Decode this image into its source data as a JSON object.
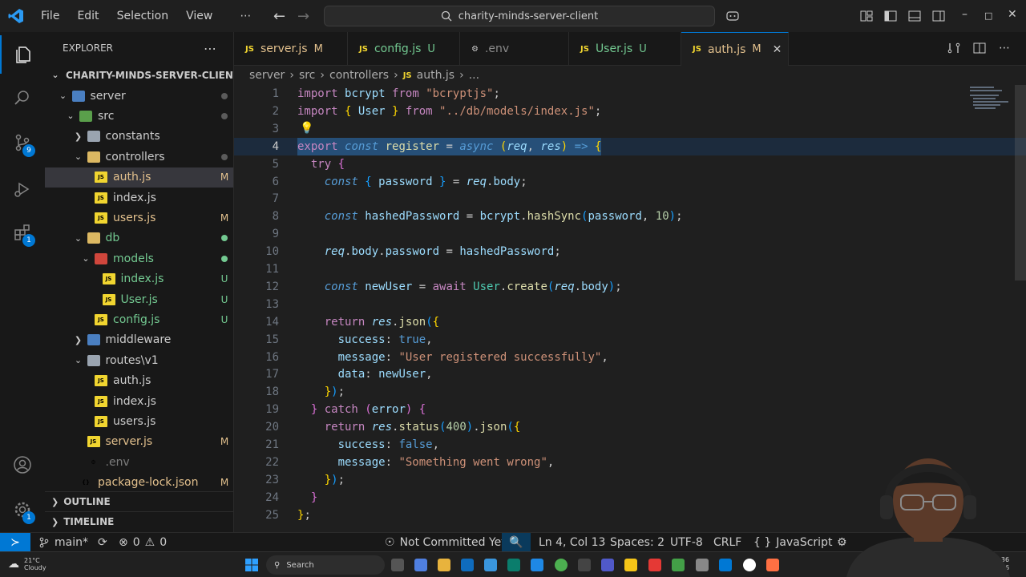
{
  "menu": [
    "File",
    "Edit",
    "Selection",
    "View",
    "⋯"
  ],
  "command_center": "charity-minds-server-client",
  "explorer": {
    "title": "EXPLORER",
    "root": "CHARITY-MINDS-SERVER-CLIENT",
    "tree": [
      {
        "label": "server",
        "kind": "folder",
        "color": "blue",
        "open": true,
        "indent": 1,
        "status": "dot"
      },
      {
        "label": "src",
        "kind": "folder",
        "color": "green",
        "open": true,
        "indent": 2,
        "status": "dot"
      },
      {
        "label": "constants",
        "kind": "folder",
        "color": "gray",
        "open": false,
        "indent": 3,
        "status": ""
      },
      {
        "label": "controllers",
        "kind": "folder",
        "color": "yellow",
        "open": true,
        "indent": 3,
        "status": "dot"
      },
      {
        "label": "auth.js",
        "kind": "js",
        "indent": 4,
        "status": "M",
        "state": "mod",
        "selected": true
      },
      {
        "label": "index.js",
        "kind": "js",
        "indent": 4,
        "status": "",
        "state": ""
      },
      {
        "label": "users.js",
        "kind": "js",
        "indent": 4,
        "status": "M",
        "state": "mod"
      },
      {
        "label": "db",
        "kind": "folder",
        "color": "yellow",
        "open": true,
        "indent": 3,
        "status": "dot",
        "state": "untracked"
      },
      {
        "label": "models",
        "kind": "folder",
        "color": "red",
        "open": true,
        "indent": 4,
        "status": "dot",
        "state": "untracked"
      },
      {
        "label": "index.js",
        "kind": "js",
        "indent": 5,
        "status": "U",
        "state": "untracked"
      },
      {
        "label": "User.js",
        "kind": "js",
        "indent": 5,
        "status": "U",
        "state": "untracked"
      },
      {
        "label": "config.js",
        "kind": "js",
        "indent": 4,
        "status": "U",
        "state": "untracked"
      },
      {
        "label": "middleware",
        "kind": "folder",
        "color": "blue",
        "open": false,
        "indent": 3,
        "status": ""
      },
      {
        "label": "routes\\v1",
        "kind": "folder",
        "color": "gray",
        "open": true,
        "indent": 3,
        "status": ""
      },
      {
        "label": "auth.js",
        "kind": "js",
        "indent": 4,
        "status": "",
        "state": ""
      },
      {
        "label": "index.js",
        "kind": "js",
        "indent": 4,
        "status": "",
        "state": ""
      },
      {
        "label": "users.js",
        "kind": "js",
        "indent": 4,
        "status": "",
        "state": ""
      },
      {
        "label": "server.js",
        "kind": "js",
        "indent": 3,
        "status": "M",
        "state": "mod"
      },
      {
        "label": ".env",
        "kind": "env",
        "indent": 3,
        "status": "",
        "state": "dim"
      },
      {
        "label": "package-lock.json",
        "kind": "json",
        "indent": 2,
        "status": "M",
        "state": "mod"
      }
    ],
    "outline": "OUTLINE",
    "timeline": "TIMELINE"
  },
  "tabs": [
    {
      "label": "server.js",
      "state": "M",
      "kind": "js"
    },
    {
      "label": "config.js",
      "state": "U",
      "kind": "js"
    },
    {
      "label": ".env",
      "state": "",
      "kind": "env"
    },
    {
      "label": "User.js",
      "state": "U",
      "kind": "js"
    },
    {
      "label": "auth.js",
      "state": "M",
      "kind": "js",
      "active": true
    }
  ],
  "breadcrumb": [
    "server",
    "src",
    "controllers",
    "auth.js",
    "..."
  ],
  "code": [
    [
      [
        "kw",
        "import "
      ],
      [
        "var",
        "bcrypt "
      ],
      [
        "kw",
        "from "
      ],
      [
        "str",
        "\"bcryptjs\""
      ],
      [
        "pun",
        ";"
      ]
    ],
    [
      [
        "kw",
        "import "
      ],
      [
        "br1",
        "{ "
      ],
      [
        "var",
        "User "
      ],
      [
        "br1",
        "} "
      ],
      [
        "kw",
        "from "
      ],
      [
        "str",
        "\"../db/models/index.js\""
      ],
      [
        "pun",
        ";"
      ]
    ],
    [],
    [
      [
        "kw",
        "export "
      ],
      [
        "kwb",
        "const "
      ],
      [
        "fn",
        "register "
      ],
      [
        "pun",
        "= "
      ],
      [
        "kwb",
        "async "
      ],
      [
        "br1",
        "("
      ],
      [
        "param",
        "req"
      ],
      [
        "pun",
        ", "
      ],
      [
        "param",
        "res"
      ],
      [
        "br1",
        ") "
      ],
      [
        "kwb",
        "=> "
      ],
      [
        "br1",
        "{"
      ]
    ],
    [
      [
        "pun",
        "  "
      ],
      [
        "kw",
        "try "
      ],
      [
        "br2",
        "{"
      ]
    ],
    [
      [
        "pun",
        "    "
      ],
      [
        "kwb",
        "const "
      ],
      [
        "br3",
        "{ "
      ],
      [
        "var",
        "password "
      ],
      [
        "br3",
        "} "
      ],
      [
        "pun",
        "= "
      ],
      [
        "param",
        "req"
      ],
      [
        "pun",
        "."
      ],
      [
        "var",
        "body"
      ],
      [
        "pun",
        ";"
      ]
    ],
    [],
    [
      [
        "pun",
        "    "
      ],
      [
        "kwb",
        "const "
      ],
      [
        "var",
        "hashedPassword "
      ],
      [
        "pun",
        "= "
      ],
      [
        "var",
        "bcrypt"
      ],
      [
        "pun",
        "."
      ],
      [
        "fn",
        "hashSync"
      ],
      [
        "br3",
        "("
      ],
      [
        "var",
        "password"
      ],
      [
        "pun",
        ", "
      ],
      [
        "num",
        "10"
      ],
      [
        "br3",
        ")"
      ],
      [
        "pun",
        ";"
      ]
    ],
    [],
    [
      [
        "pun",
        "    "
      ],
      [
        "param",
        "req"
      ],
      [
        "pun",
        "."
      ],
      [
        "var",
        "body"
      ],
      [
        "pun",
        "."
      ],
      [
        "var",
        "password "
      ],
      [
        "pun",
        "= "
      ],
      [
        "var",
        "hashedPassword"
      ],
      [
        "pun",
        ";"
      ]
    ],
    [],
    [
      [
        "pun",
        "    "
      ],
      [
        "kwb",
        "const "
      ],
      [
        "var",
        "newUser "
      ],
      [
        "pun",
        "= "
      ],
      [
        "kw",
        "await "
      ],
      [
        "cls",
        "User"
      ],
      [
        "pun",
        "."
      ],
      [
        "fn",
        "create"
      ],
      [
        "br3",
        "("
      ],
      [
        "param",
        "req"
      ],
      [
        "pun",
        "."
      ],
      [
        "var",
        "body"
      ],
      [
        "br3",
        ")"
      ],
      [
        "pun",
        ";"
      ]
    ],
    [],
    [
      [
        "pun",
        "    "
      ],
      [
        "kw",
        "return "
      ],
      [
        "param",
        "res"
      ],
      [
        "pun",
        "."
      ],
      [
        "fn",
        "json"
      ],
      [
        "br3",
        "("
      ],
      [
        "br1",
        "{"
      ]
    ],
    [
      [
        "pun",
        "      "
      ],
      [
        "var",
        "success"
      ],
      [
        "pun",
        ": "
      ],
      [
        "bool",
        "true"
      ],
      [
        "pun",
        ","
      ]
    ],
    [
      [
        "pun",
        "      "
      ],
      [
        "var",
        "message"
      ],
      [
        "pun",
        ": "
      ],
      [
        "str",
        "\"User registered successfully\""
      ],
      [
        "pun",
        ","
      ]
    ],
    [
      [
        "pun",
        "      "
      ],
      [
        "var",
        "data"
      ],
      [
        "pun",
        ": "
      ],
      [
        "var",
        "newUser"
      ],
      [
        "pun",
        ","
      ]
    ],
    [
      [
        "pun",
        "    "
      ],
      [
        "br1",
        "}"
      ],
      [
        "br3",
        ")"
      ],
      [
        "pun",
        ";"
      ]
    ],
    [
      [
        "pun",
        "  "
      ],
      [
        "br2",
        "} "
      ],
      [
        "kw",
        "catch "
      ],
      [
        "br2",
        "("
      ],
      [
        "var",
        "error"
      ],
      [
        "br2",
        ") "
      ],
      [
        "br2",
        "{"
      ]
    ],
    [
      [
        "pun",
        "    "
      ],
      [
        "kw",
        "return "
      ],
      [
        "param",
        "res"
      ],
      [
        "pun",
        "."
      ],
      [
        "fn",
        "status"
      ],
      [
        "br3",
        "("
      ],
      [
        "num",
        "400"
      ],
      [
        "br3",
        ")"
      ],
      [
        "pun",
        "."
      ],
      [
        "fn",
        "json"
      ],
      [
        "br3",
        "("
      ],
      [
        "br1",
        "{"
      ]
    ],
    [
      [
        "pun",
        "      "
      ],
      [
        "var",
        "success"
      ],
      [
        "pun",
        ": "
      ],
      [
        "bool",
        "false"
      ],
      [
        "pun",
        ","
      ]
    ],
    [
      [
        "pun",
        "      "
      ],
      [
        "var",
        "message"
      ],
      [
        "pun",
        ": "
      ],
      [
        "str",
        "\"Something went wrong\""
      ],
      [
        "pun",
        ","
      ]
    ],
    [
      [
        "pun",
        "    "
      ],
      [
        "br1",
        "}"
      ],
      [
        "br3",
        ")"
      ],
      [
        "pun",
        ";"
      ]
    ],
    [
      [
        "pun",
        "  "
      ],
      [
        "br2",
        "}"
      ]
    ],
    [
      [
        "br1",
        "}"
      ],
      [
        "pun",
        ";"
      ]
    ]
  ],
  "current_line": 4,
  "status": {
    "branch": "main*",
    "errors": "0",
    "warnings": "0",
    "blame": "Not Committed Yet",
    "position": "Ln 4, Col 13",
    "spaces": "Spaces: 2",
    "encoding": "UTF-8",
    "eol": "CRLF",
    "language": "JavaScript"
  },
  "taskbar": {
    "weather_temp": "21°C",
    "weather_text": "Cloudy",
    "search": "Search",
    "time": "20:36",
    "date": "2026"
  },
  "colors": {
    "accent": "#0078d4",
    "modified": "#e2c08d",
    "untracked": "#73c991"
  }
}
